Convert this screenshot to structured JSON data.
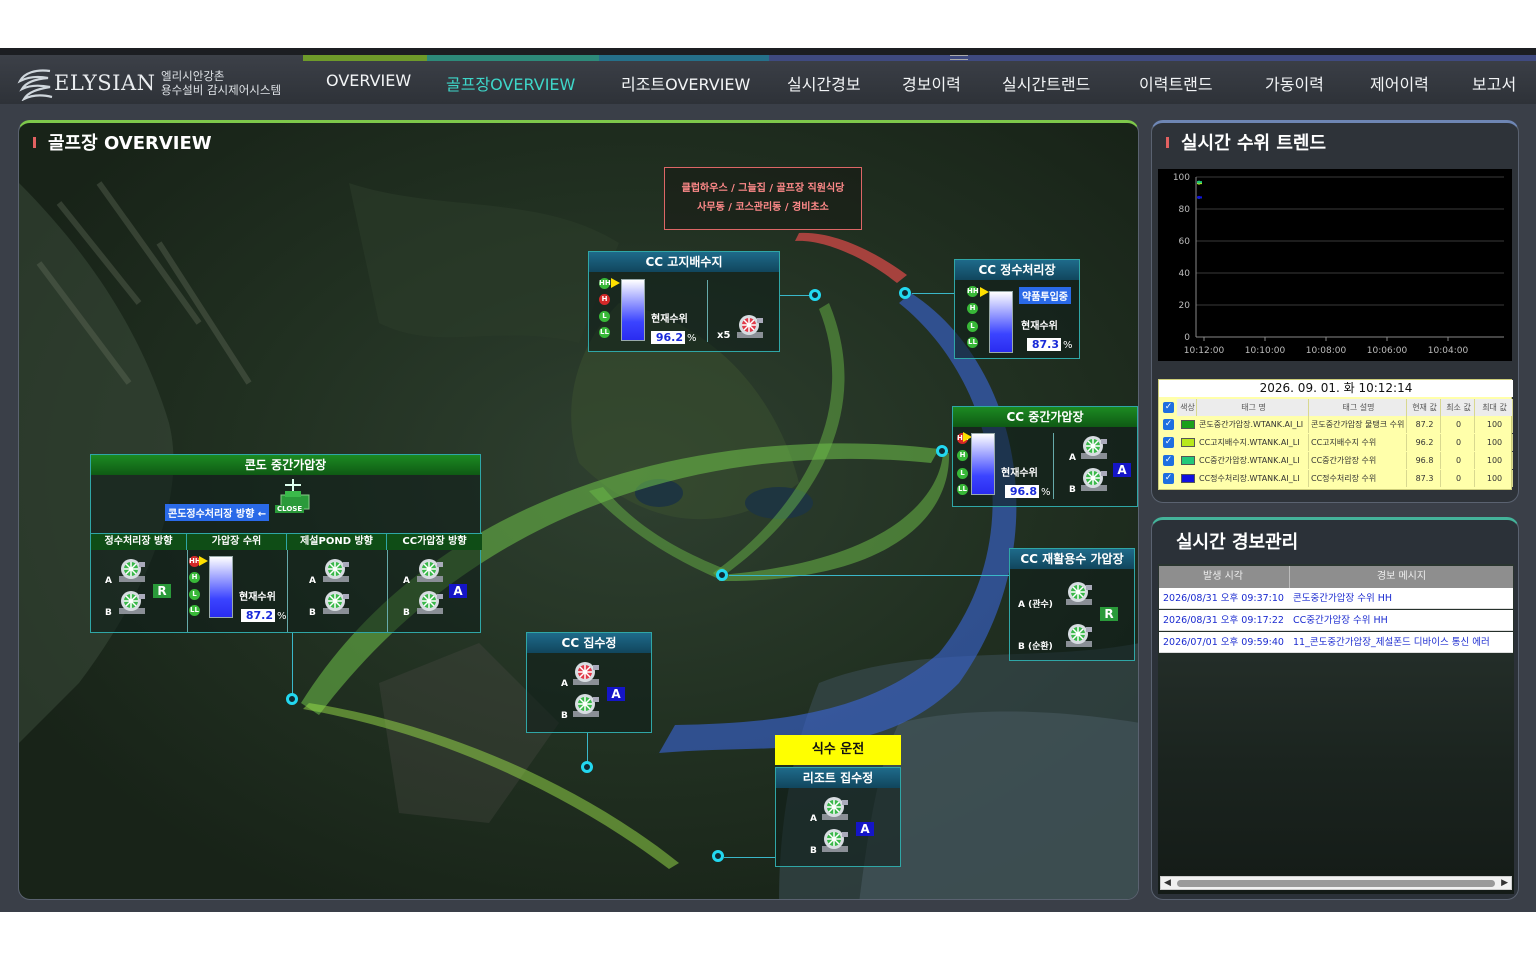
{
  "app": {
    "brand": "ELYSIAN",
    "subtitle_line1": "엘리시안강촌",
    "subtitle_line2": "용수설비 감시제어시스템"
  },
  "nav": [
    {
      "label": "OVERVIEW"
    },
    {
      "label": "골프장OVERVIEW",
      "active": true
    },
    {
      "label": "리조트OVERVIEW"
    },
    {
      "label": "실시간경보"
    },
    {
      "label": "경보이력"
    },
    {
      "label": "실시간트랜드"
    },
    {
      "label": "이력트랜드"
    },
    {
      "label": "가동이력"
    },
    {
      "label": "제어이력"
    },
    {
      "label": "보고서"
    }
  ],
  "map": {
    "title": "골프장 OVERVIEW",
    "note_line1": "클럽하우스 / 그늘집 / 골프장 직원식당",
    "note_line2": "사무동 / 코스관리동 / 경비초소",
    "level_label": "현재수위",
    "pct": "%",
    "high_reservoir": {
      "title": "CC 고지배수지",
      "level": "96.2",
      "multiplier": "x5"
    },
    "water_treatment": {
      "title": "CC 정수처리장",
      "badge": "약품투입중",
      "level": "87.3"
    },
    "mid_pressure": {
      "title": "CC 중간가압장",
      "level": "96.8",
      "mode": "A",
      "a": "A",
      "b": "B"
    },
    "recycled": {
      "title": "CC 재활용수 가압장",
      "a": "A (관수)",
      "b": "B (순환)",
      "mode": "R"
    },
    "condo": {
      "title": "콘도 중간가압장",
      "direction": "콘도정수처리장 방향 ←",
      "valve": "CLOSE",
      "sections": [
        "정수처리장 방향",
        "가압장 수위",
        "제설POND 방향",
        "CC가압장 방향"
      ],
      "level": "87.2",
      "mode_left": "R",
      "mode_right": "A",
      "a": "A",
      "b": "B"
    },
    "intake": {
      "title": "CC 집수정",
      "mode": "A",
      "a": "A",
      "b": "B"
    },
    "drinking": "식수 운전",
    "resort_intake": {
      "title": "리조트 집수정",
      "mode": "A",
      "a": "A",
      "b": "B"
    }
  },
  "trend": {
    "title": "실시간 수위 트렌드",
    "y_ticks": [
      "100",
      "80",
      "60",
      "40",
      "20",
      "0"
    ],
    "x_ticks": [
      "10:12:00",
      "10:10:00",
      "10:08:00",
      "10:06:00",
      "10:04:00"
    ],
    "date": "2026. 09. 01. 화 10:12:14",
    "columns": [
      "색상",
      "태그 명",
      "태그 설명",
      "현재 값",
      "최소 값",
      "최대 값"
    ],
    "rows": [
      {
        "color": "#1aa01a",
        "tag": "콘도중간가압장.WTANK.AI_LI",
        "desc": "콘도중간가압장 물탱크 수위",
        "cur": "87.2",
        "min": "0",
        "max": "100"
      },
      {
        "color": "#b8e81a",
        "tag": "CC고지배수지.WTANK.AI_LI",
        "desc": "CC고지배수지 수위",
        "cur": "96.2",
        "min": "0",
        "max": "100"
      },
      {
        "color": "#22c87a",
        "tag": "CC중간가압장.WTANK.AI_LI",
        "desc": "CC중간가압장 수위",
        "cur": "96.8",
        "min": "0",
        "max": "100"
      },
      {
        "color": "#1010e0",
        "tag": "CC정수처리장.WTANK.AI_LI",
        "desc": "CC정수처리장 수위",
        "cur": "87.3",
        "min": "0",
        "max": "100"
      }
    ],
    "chart_data": {
      "type": "line",
      "x": [
        "10:12:00",
        "10:10:00",
        "10:08:00",
        "10:06:00",
        "10:04:00"
      ],
      "ylim": [
        0,
        100
      ],
      "series": [
        {
          "color": "#1aa01a",
          "values": [
            87.2
          ]
        },
        {
          "color": "#b8e81a",
          "values": [
            96.2
          ]
        },
        {
          "color": "#22c87a",
          "values": [
            96.8
          ]
        },
        {
          "color": "#1010e0",
          "values": [
            87.3
          ]
        }
      ]
    }
  },
  "alarm": {
    "title": "실시간 경보관리",
    "col_time": "발생 시각",
    "col_msg": "경보 메시지",
    "rows": [
      {
        "time": "2026/08/31 오후 09:37:10",
        "msg": "콘도중간가압장 수위 HH"
      },
      {
        "time": "2026/08/31 오후 09:17:22",
        "msg": "CC중간가압장 수위 HH"
      },
      {
        "time": "2026/07/01 오후 09:59:40",
        "msg": "11_콘도중간가압장_제설폰드 디바이스 통신 에러"
      }
    ]
  }
}
